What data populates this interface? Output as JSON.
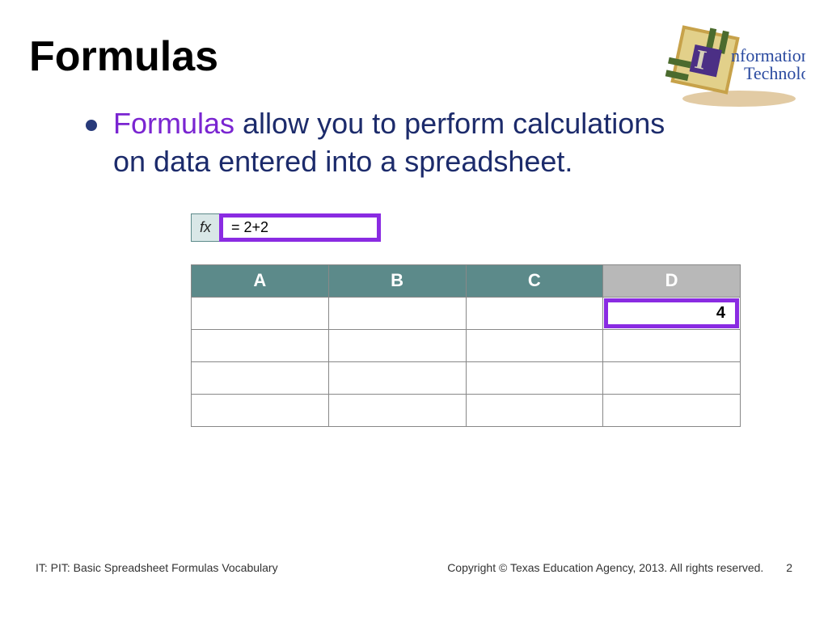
{
  "title": "Formulas",
  "bullet": {
    "emph": "Formulas",
    "rest": " allow you to perform calculations on data entered into a spreadsheet."
  },
  "formula_bar": {
    "fx_label": "fx",
    "value": "= 2+2"
  },
  "columns": [
    "A",
    "B",
    "C",
    "D"
  ],
  "result_value": "4",
  "footer": {
    "left": "IT: PIT: Basic Spreadsheet Formulas Vocabulary",
    "right": "Copyright © Texas Education Agency, 2013. All rights reserved.",
    "page": "2"
  },
  "logo": {
    "line1": "nformation",
    "line2": "Technology"
  }
}
